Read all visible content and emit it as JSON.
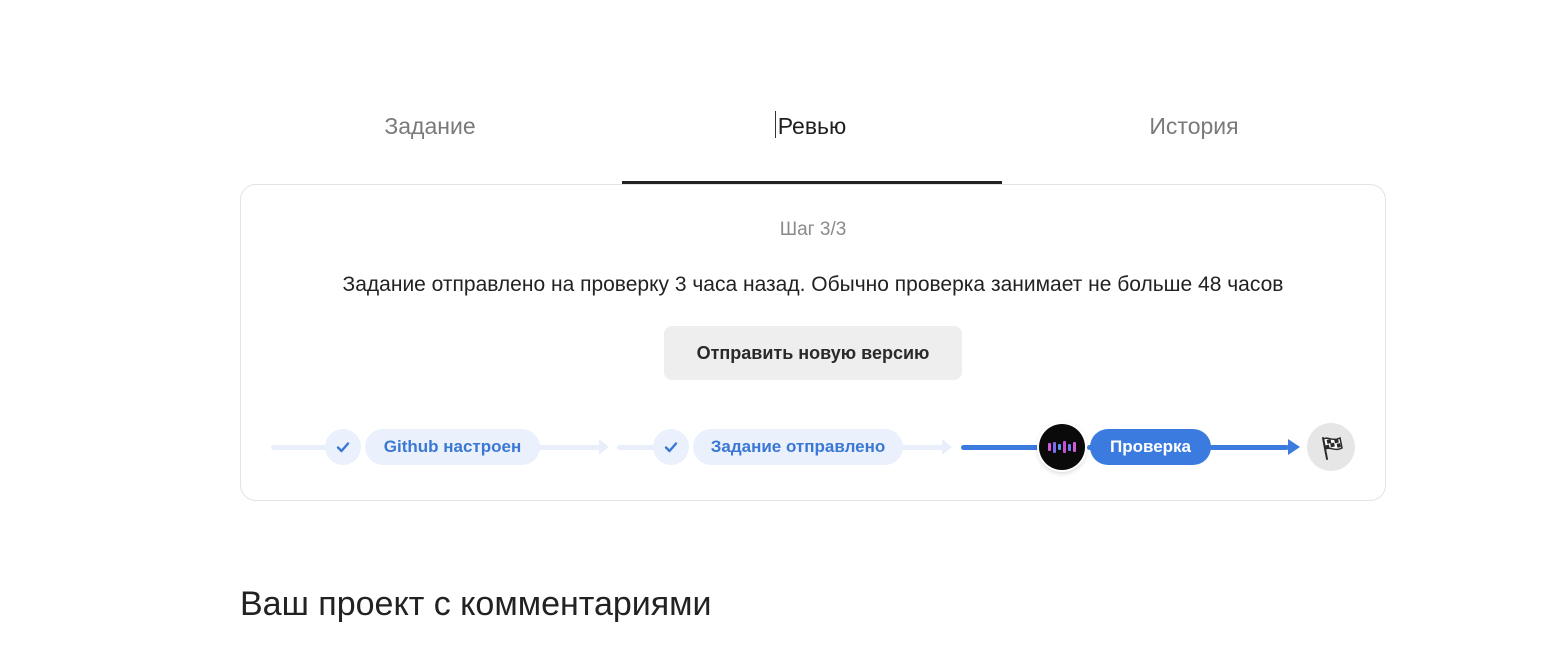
{
  "tabs": [
    {
      "label": "Задание",
      "active": false
    },
    {
      "label": "Ревью",
      "active": true
    },
    {
      "label": "История",
      "active": false
    }
  ],
  "review_card": {
    "step": "Шаг 3/3",
    "message": "Задание отправлено на проверку 3 часа назад. Обычно проверка занимает не больше 48 часов",
    "resubmit_button": "Отправить новую версию"
  },
  "progress": {
    "stages": [
      {
        "label": "Github настроен",
        "status": "done",
        "icon": "check-icon"
      },
      {
        "label": "Задание отправлено",
        "status": "done",
        "icon": "check-icon"
      },
      {
        "label": "Проверка",
        "status": "current",
        "icon": "reviewer-avatar"
      }
    ],
    "finish_icon": "checkered-flag-icon"
  },
  "colors": {
    "accent": "#3b7be0",
    "accent_pale": "#eaf1fc",
    "done_text": "#3a78d4",
    "text": "#222222",
    "muted": "#7a7a7a"
  },
  "section": {
    "heading": "Ваш проект с комментариями"
  }
}
